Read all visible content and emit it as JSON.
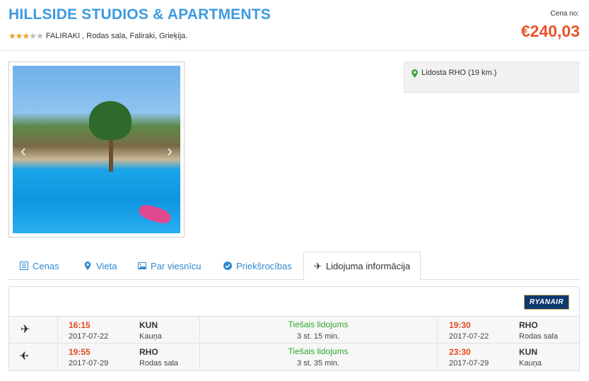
{
  "hotel": {
    "name": "HILLSIDE STUDIOS & APARTMENTS",
    "rating": 3,
    "rating_max": 5,
    "location": "FALIRAKI , Rodas sala, Faliraki, Grieķija.",
    "price_label": "Cena no:",
    "price": "€240,03"
  },
  "gallery": {
    "prev_glyph": "‹",
    "next_glyph": "›"
  },
  "airport": {
    "icon": "map-pin-icon",
    "text": "Lidosta RHO (19 km.)"
  },
  "tabs": [
    {
      "label": "Cenas",
      "icon": "list-icon"
    },
    {
      "label": "Vieta",
      "icon": "map-pin-icon"
    },
    {
      "label": "Par viesnīcu",
      "icon": "image-icon"
    },
    {
      "label": "Priekšrocības",
      "icon": "check-circle-icon"
    },
    {
      "label": "Lidojuma informācija",
      "icon": "plane-icon",
      "active": true
    }
  ],
  "flights": {
    "airline": "RYANAIR",
    "rows": [
      {
        "direction_icon": "plane-departure-icon",
        "dep_time": "16:15",
        "dep_date": "2017-07-22",
        "dep_code": "KUN",
        "dep_city": "Kauņa",
        "type": "Tiešais lidojums",
        "duration": "3 st. 15 min.",
        "arr_time": "19:30",
        "arr_date": "2017-07-22",
        "arr_code": "RHO",
        "arr_city": "Rodas sala"
      },
      {
        "direction_icon": "plane-return-icon",
        "dep_time": "19:55",
        "dep_date": "2017-07-29",
        "dep_code": "RHO",
        "dep_city": "Rodas sala",
        "type": "Tiešais lidojums",
        "duration": "3 st. 35 min.",
        "arr_time": "23:30",
        "arr_date": "2017-07-29",
        "arr_code": "KUN",
        "arr_city": "Kauņa"
      }
    ]
  },
  "colors": {
    "title": "#3d9ae0",
    "price": "#e8542a",
    "time": "#e24a1e",
    "direct": "#2ea72e",
    "tab_link": "#2f87d0",
    "star_on": "#f0a020",
    "star_off": "#bdbdbd",
    "ryanair_bg": "#10386f"
  }
}
